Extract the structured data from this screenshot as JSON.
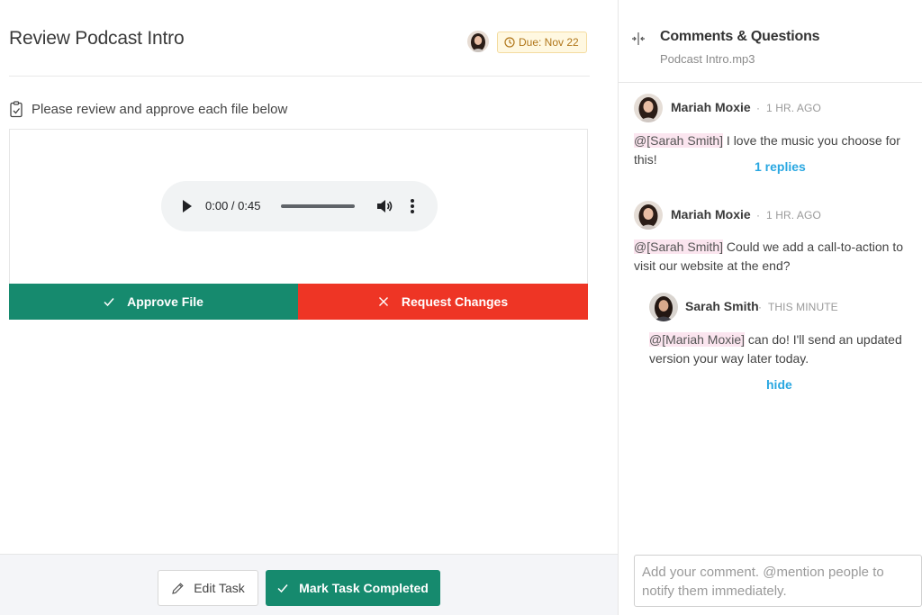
{
  "task": {
    "title": "Review Podcast Intro",
    "due_label": "Due: Nov 22",
    "instructions": "Please review and approve each file below"
  },
  "player": {
    "time": "0:00 / 0:45",
    "progress": 0.0
  },
  "actions": {
    "approve_label": "Approve File",
    "request_label": "Request Changes"
  },
  "footer": {
    "edit_label": "Edit Task",
    "complete_label": "Mark Task Completed"
  },
  "comments_panel": {
    "title": "Comments & Questions",
    "file_name": "Podcast Intro.mp3",
    "comments": [
      {
        "author": "Mariah Moxie",
        "time": "1 HR. AGO",
        "mention": "@[Sarah Smith]",
        "text": " I love the music you choose for this!",
        "replies_link": "1 replies"
      },
      {
        "author": "Mariah Moxie",
        "time": "1 HR. AGO",
        "mention": "@[Sarah Smith]",
        "text_line1": " Could we add a call-to-action to",
        "text_line2": "visit our website at the end?"
      }
    ],
    "reply": {
      "author": "Sarah Smith",
      "time": "THIS MINUTE",
      "mention": "@[Mariah Moxie]",
      "text_line1": " can do! I'll send an updated",
      "text_line2": "version your way later today.",
      "hide_link": "hide"
    },
    "separator": "·",
    "input_placeholder": "Add your comment. @mention people to notify them immediately."
  },
  "colors": {
    "approve": "#168a6e",
    "request": "#ee3525",
    "link": "#29a7e1",
    "mention_bg": "#fbe5ef",
    "due_bg": "#fff8e1"
  }
}
